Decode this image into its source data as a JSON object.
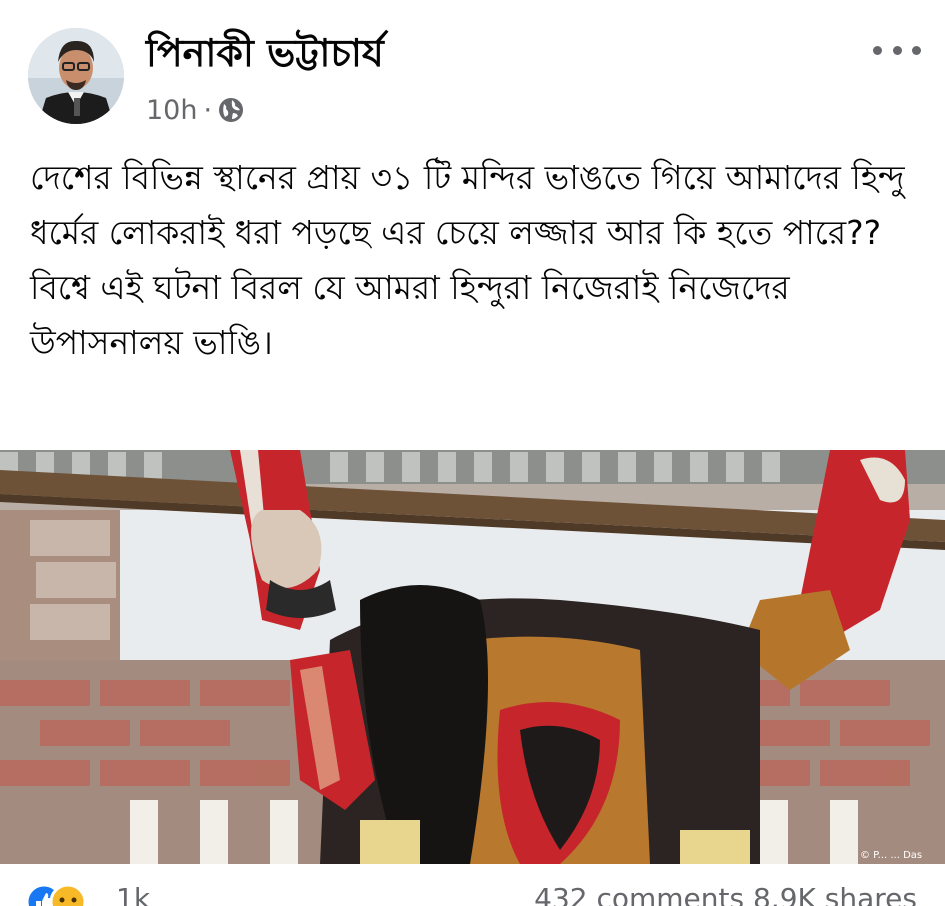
{
  "post": {
    "author_name": "পিনাকী ভট্টাচার্য",
    "timestamp": "10h",
    "separator": "·",
    "audience_icon": "globe-icon",
    "more_icon": "more-options-icon",
    "text_paragraphs": [
      "দেশের বিভিন্ন স্থানের প্রায় ৩১ টি মন্দির ভাঙতে গিয়ে আমাদের হিন্দু ধর্মের লোকরাই ধরা পড়ছে এর চেয়ে লজ্জার আর কি হতে পারে??",
      "বিশ্বে এই ঘটনা বিরল যে আমরা হিন্দুরা নিজেরাই নিজেদের উপাসনালয় ভাঙি।"
    ],
    "photo_watermark": "© P... ... Das"
  },
  "reactions": {
    "icons": [
      "like-icon",
      "sad-icon"
    ],
    "count": "1k",
    "comments": "432 comments",
    "shares": "8.9K shares"
  },
  "colors": {
    "text_primary": "#050505",
    "text_secondary": "#65676b",
    "like_blue": "#1877f2",
    "sad_yellow": "#f7b928"
  }
}
